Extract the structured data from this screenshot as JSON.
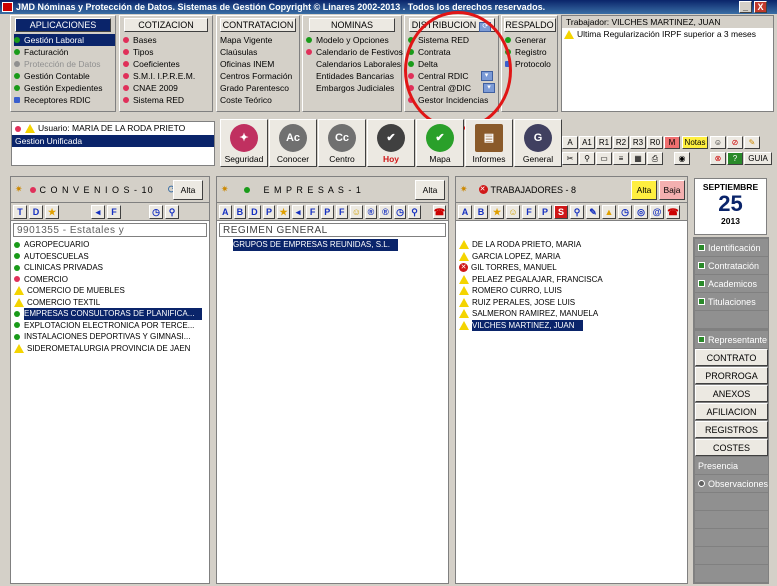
{
  "window": {
    "title": "JMD Nóminas y Protección de Datos. Sistemas de Gestión   Copyright © Linares 2002-2013 . Todos los derechos reservados.",
    "min_label": "_",
    "close_label": "X"
  },
  "menus": {
    "aplicaciones": {
      "header": "APLICACIONES",
      "items": [
        "Gestión Laboral",
        "Facturación",
        "Protección de Datos",
        "Gestión Contable",
        "Gestión Expedientes",
        "Receptores RDIC"
      ]
    },
    "cotizacion": {
      "header": "COTIZACION",
      "items": [
        "Bases",
        "Tipos",
        "Coeficientes",
        "S.M.I.  I.P.R.E.M.",
        "CNAE 2009",
        "Sistema RED"
      ]
    },
    "contratacion": {
      "header": "CONTRATACION",
      "items": [
        "Mapa Vigente",
        "Claúsulas",
        "Oficinas INEM",
        "Centros Formación",
        "Grado Parentesco",
        "Coste Teórico"
      ]
    },
    "nominas": {
      "header": "NOMINAS",
      "items": [
        "Modelo y Opciones",
        "Calendario de Festivos",
        "Calendarios Laborales",
        "Entidades Bancarias",
        "Embargos Judiciales"
      ]
    },
    "distribucion": {
      "header": "DISTRIBUCION",
      "items": [
        "Sistema RED",
        "Contrata",
        "Delta",
        "Central  RDIC",
        "Central  @DIC",
        "Gestor Incidencias"
      ]
    },
    "respaldo": {
      "header": "RESPALDO",
      "items": [
        "Generar",
        "Registro",
        "Protocolo"
      ]
    }
  },
  "trabajador": {
    "header": "Trabajador: VILCHES MARTINEZ, JUAN",
    "message": "Ultima Regularización IRPF superior a 3 meses"
  },
  "user": {
    "label": "Usuario: MARIA DE LA RODA PRIETO",
    "mode": "Gestion Unificada"
  },
  "toolbar": {
    "seguridad": "Seguridad",
    "conocer": "Conocer",
    "centro": "Centro",
    "hoy": "Hoy",
    "mapa": "Mapa",
    "informes": "Informes",
    "general": "General",
    "conocer_icon_text": "Ac",
    "centro_icon_text": "Cc",
    "general_icon_text": "G"
  },
  "smalltools": {
    "row1": [
      "A",
      "A1",
      "R1",
      "R2",
      "R3",
      "R0",
      "M"
    ],
    "notas": "Notas",
    "guia": "GUIA"
  },
  "convenios": {
    "title": "C O N V E N I O S - 10",
    "alta": "Alta",
    "filter": "9901355 - Estatales y",
    "toolbar": [
      "T",
      "D",
      "F"
    ],
    "items": [
      {
        "name": "AGROPECUARIO",
        "status": "green"
      },
      {
        "name": "AUTOESCUELAS",
        "status": "green"
      },
      {
        "name": "CLINICAS PRIVADAS",
        "status": "green"
      },
      {
        "name": "COMERCIO",
        "status": "red"
      },
      {
        "name": "COMERCIO DE MUEBLES",
        "status": "warn"
      },
      {
        "name": "COMERCIO TEXTIL",
        "status": "warn"
      },
      {
        "name": "EMPRESAS CONSULTORAS DE PLANIFICA...",
        "status": "green",
        "selected": true
      },
      {
        "name": "EXPLOTACION ELECTRONICA POR TERCE...",
        "status": "green"
      },
      {
        "name": "INSTALACIONES DEPORTIVAS Y GIMNASI...",
        "status": "green"
      },
      {
        "name": "SIDEROMETALURGIA PROVINCIA DE JAEN",
        "status": "warn"
      }
    ]
  },
  "empresas": {
    "title": "E M P R E S A S - 1",
    "alta": "Alta",
    "filter": "REGIMEN GENERAL",
    "toolbar": [
      "A",
      "B",
      "D",
      "P",
      "F",
      "P",
      "F",
      "®",
      "®"
    ],
    "items": [
      {
        "name": "GRUPOS DE EMPRESAS REUNIDAS, S.L.",
        "selected": true
      }
    ]
  },
  "trabajadores": {
    "title": "TRABAJADORES - 8",
    "alta": "Alta",
    "baja": "Baja",
    "toolbar": [
      "A",
      "B",
      "F",
      "P",
      "S",
      "@"
    ],
    "items": [
      {
        "name": "DE LA RODA PRIETO, MARIA",
        "status": "warn"
      },
      {
        "name": "GARCIA LOPEZ, MARIA",
        "status": "warn"
      },
      {
        "name": "GIL TORRES, MANUEL",
        "status": "error"
      },
      {
        "name": "PELAEZ PEGALAJAR, FRANCISCA",
        "status": "warn"
      },
      {
        "name": "ROMERO CURRO, LUIS",
        "status": "warn"
      },
      {
        "name": "RUIZ PERALES, JOSE LUIS",
        "status": "warn"
      },
      {
        "name": "SALMERON RAMIREZ, MANUELA",
        "status": "warn"
      },
      {
        "name": "VILCHES MARTINEZ, JUAN",
        "status": "warn",
        "selected": true
      }
    ]
  },
  "calendar": {
    "month": "SEPTIEMBRE",
    "day": "25",
    "year": "2013"
  },
  "sidebar": {
    "identificacion": "Identificación",
    "contratacion": "Contratación",
    "academicos": "Academicos",
    "titulaciones": "Titulaciones",
    "representante": "Representante",
    "contrato": "CONTRATO",
    "prorroga": "PRORROGA",
    "anexos": "ANEXOS",
    "afiliacion": "AFILIACION",
    "registros": "REGISTROS",
    "costes": "COSTES",
    "presencia": "Presencia",
    "observaciones": "Observaciones"
  }
}
